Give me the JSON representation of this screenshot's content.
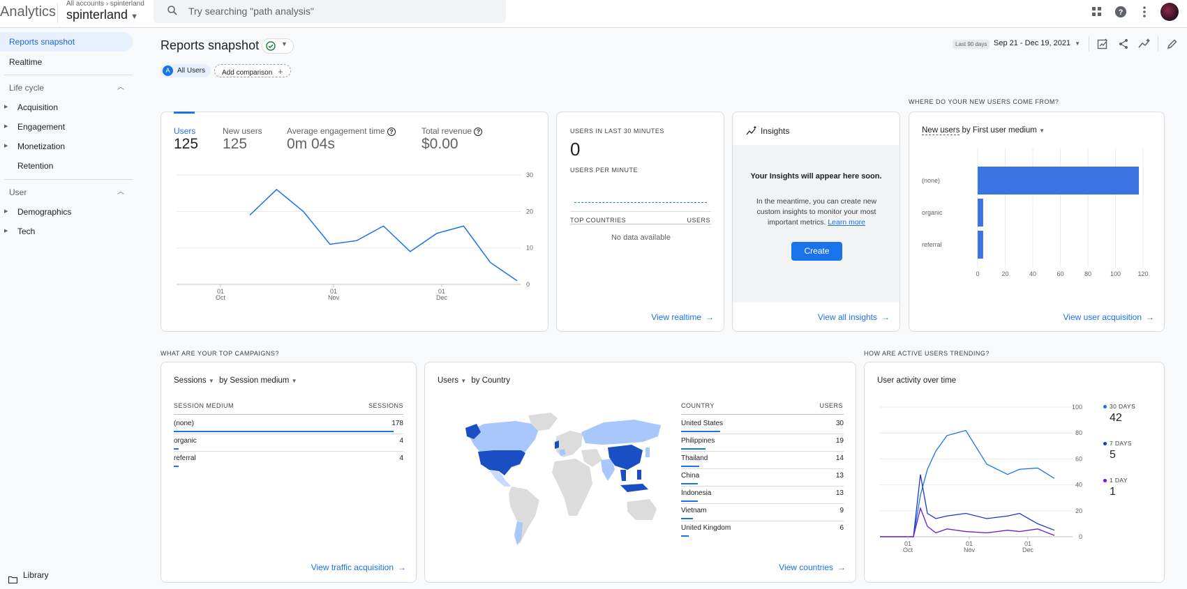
{
  "header": {
    "app_title": "Analytics",
    "breadcrumb_all": "All accounts",
    "breadcrumb_sep": "›",
    "breadcrumb_account": "spinterland",
    "property": "spinterland",
    "search_placeholder": "Try searching \"path analysis\""
  },
  "sidebar": {
    "reports_snapshot": "Reports snapshot",
    "realtime": "Realtime",
    "lifecycle": "Life cycle",
    "acquisition": "Acquisition",
    "engagement": "Engagement",
    "monetization": "Monetization",
    "retention": "Retention",
    "user": "User",
    "demographics": "Demographics",
    "tech": "Tech",
    "library": "Library"
  },
  "toolbar": {
    "page_title": "Reports snapshot",
    "comparison_letter": "A",
    "comparison_all_users": "All Users",
    "add_comparison": "Add comparison",
    "date_tag": "Last 90 days",
    "date_range": "Sep 21 - Dec 19, 2021"
  },
  "overview": {
    "metrics": [
      {
        "label": "Users",
        "value": "125"
      },
      {
        "label": "New users",
        "value": "125"
      },
      {
        "label": "Average engagement time",
        "value": "0m 04s"
      },
      {
        "label": "Total revenue",
        "value": "$0.00"
      }
    ],
    "y_ticks": [
      "30",
      "20",
      "10",
      "0"
    ],
    "x_ticks": [
      {
        "day": "01",
        "month": "Oct"
      },
      {
        "day": "01",
        "month": "Nov"
      },
      {
        "day": "01",
        "month": "Dec"
      }
    ]
  },
  "realtime": {
    "title": "USERS IN LAST 30 MINUTES",
    "value": "0",
    "per_minute": "USERS PER MINUTE",
    "top_countries": "TOP COUNTRIES",
    "users": "USERS",
    "empty": "No data available",
    "link": "View realtime"
  },
  "insights": {
    "title": "Insights",
    "headline": "Your Insights will appear here soon.",
    "body": "In the meantime, you can create new custom insights to monitor your most important metrics.",
    "learn_more": "Learn more",
    "create": "Create",
    "link": "View all insights"
  },
  "new_users": {
    "section_title": "WHERE DO YOUR NEW USERS COME FROM?",
    "dim_metric": "New users",
    "dim_by": "by First user medium",
    "link": "View user acquisition"
  },
  "campaigns": {
    "section_title": "WHAT ARE YOUR TOP CAMPAIGNS?",
    "metric": "Sessions",
    "dimension": "by Session medium",
    "col_medium": "SESSION MEDIUM",
    "col_sessions": "SESSIONS",
    "rows": [
      {
        "name": "(none)",
        "value": "178",
        "frac": 1.0
      },
      {
        "name": "organic",
        "value": "4",
        "frac": 0.022
      },
      {
        "name": "referral",
        "value": "4",
        "frac": 0.022
      }
    ],
    "link": "View traffic acquisition"
  },
  "countries": {
    "metric": "Users",
    "dimension": "by Country",
    "col_country": "COUNTRY",
    "col_users": "USERS",
    "rows": [
      {
        "name": "United States",
        "value": "30",
        "frac": 1.0
      },
      {
        "name": "Philippines",
        "value": "19",
        "frac": 0.63
      },
      {
        "name": "Thailand",
        "value": "14",
        "frac": 0.47
      },
      {
        "name": "China",
        "value": "13",
        "frac": 0.43
      },
      {
        "name": "Indonesia",
        "value": "13",
        "frac": 0.43
      },
      {
        "name": "Vietnam",
        "value": "9",
        "frac": 0.3
      },
      {
        "name": "United Kingdom",
        "value": "6",
        "frac": 0.2
      }
    ],
    "link": "View countries"
  },
  "trend": {
    "section_title": "HOW ARE ACTIVE USERS TRENDING?",
    "title": "User activity over time",
    "y_ticks": [
      "100",
      "80",
      "60",
      "40",
      "20",
      "0"
    ],
    "x_ticks": [
      {
        "day": "01",
        "month": "Oct"
      },
      {
        "day": "01",
        "month": "Nov"
      },
      {
        "day": "01",
        "month": "Dec"
      }
    ],
    "legend": [
      {
        "label": "30 DAYS",
        "value": "42",
        "color": "#1a73e8"
      },
      {
        "label": "7 DAYS",
        "value": "5",
        "color": "#1a37c8"
      },
      {
        "label": "1 DAY",
        "value": "1",
        "color": "#6f1ad6"
      }
    ]
  },
  "chart_data": [
    {
      "type": "line",
      "title": "",
      "x": [
        "Sep 30",
        "Oct 8",
        "Oct 16",
        "Oct 24",
        "Nov 1",
        "Nov 9",
        "Nov 17",
        "Nov 25",
        "Dec 3",
        "Dec 11",
        "Dec 19"
      ],
      "series": [
        {
          "name": "Users",
          "values": [
            19,
            26,
            20,
            11,
            12,
            16,
            9,
            14,
            16,
            6,
            1
          ]
        }
      ],
      "ylim": [
        0,
        30
      ],
      "grid": true
    },
    {
      "type": "bar",
      "title": "",
      "categories": [
        "(none)",
        "organic",
        "referral"
      ],
      "values": [
        117,
        4,
        4
      ],
      "xlim": [
        0,
        120
      ],
      "x_ticks": [
        "0",
        "20",
        "40",
        "60",
        "80",
        "100",
        "120"
      ]
    },
    {
      "type": "line",
      "title": "",
      "x": [
        "Sep 21",
        "Oct 15",
        "Oct 20",
        "Oct 25",
        "Oct 30",
        "Nov 5",
        "Nov 15",
        "Nov 25",
        "Dec 5",
        "Dec 10",
        "Dec 15",
        "Dec 19"
      ],
      "series": [
        {
          "name": "30 DAYS",
          "values": [
            0,
            0,
            32,
            52,
            66,
            78,
            82,
            56,
            48,
            52,
            53,
            45
          ]
        },
        {
          "name": "7 DAYS",
          "values": [
            0,
            0,
            48,
            18,
            14,
            16,
            18,
            14,
            16,
            18,
            10,
            5
          ]
        },
        {
          "name": "1 DAY",
          "values": [
            0,
            0,
            22,
            8,
            3,
            6,
            4,
            3,
            5,
            4,
            6,
            1
          ]
        }
      ],
      "ylim": [
        0,
        100
      ]
    }
  ]
}
